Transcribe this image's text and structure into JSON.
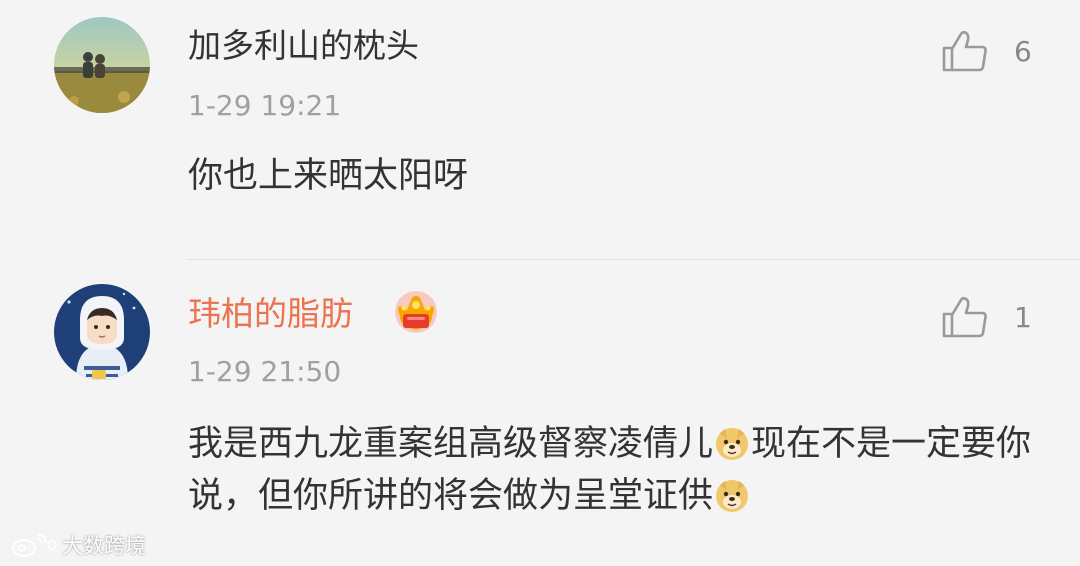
{
  "comments": [
    {
      "username": "加多利山的枕头",
      "timestamp": "1-29 19:21",
      "text": "你也上来晒太阳呀",
      "likes": "6",
      "avatar_icon": "avatar-landscape-couple",
      "vip": false
    },
    {
      "username": "玮柏的脂肪",
      "timestamp": "1-29 21:50",
      "text_part1": "我是西九龙重案组高级督察凌倩儿",
      "text_part2": "现在不是一定要你说，但你所讲的将会做为呈堂证供",
      "likes": "1",
      "avatar_icon": "avatar-astronaut-anime",
      "vip": true,
      "vip_badge_icon": "crown-badge-icon",
      "emoji": "doge-emoji"
    }
  ],
  "colors": {
    "background": "#f4f4f4",
    "vip_username": "#eb7350",
    "username": "#333333",
    "timestamp": "#a0a0a0",
    "like_count": "#888888"
  },
  "watermark": {
    "text": "大数跨境",
    "icon": "weibo-logo-icon"
  }
}
